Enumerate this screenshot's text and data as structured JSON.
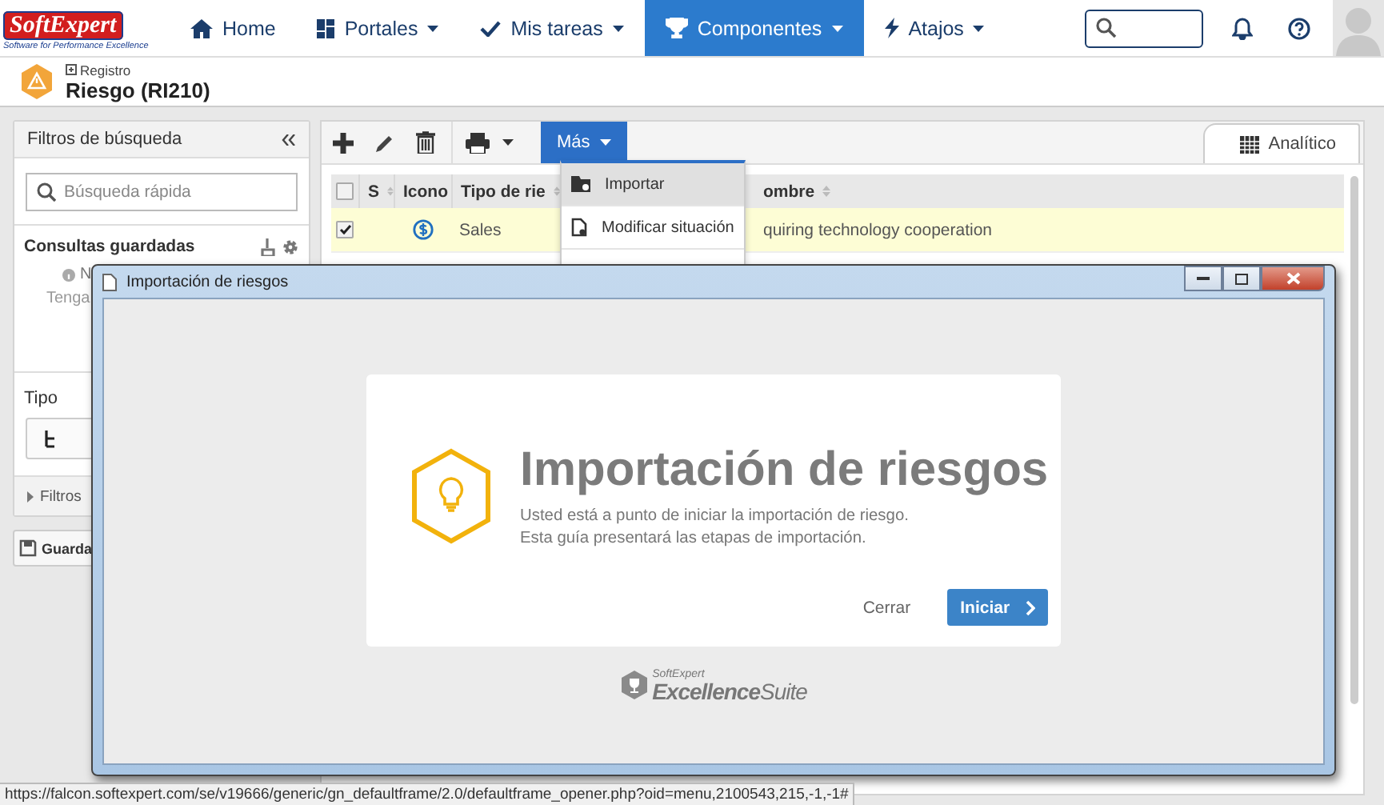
{
  "nav": {
    "logo": {
      "part_a": "Soft",
      "part_b": "Expert",
      "tagline": "Software for Performance Excellence"
    },
    "items": [
      {
        "label": "Home",
        "dropdown": false,
        "selected": false
      },
      {
        "label": "Portales",
        "dropdown": true,
        "selected": false
      },
      {
        "label": "Mis tareas",
        "dropdown": true,
        "selected": false
      },
      {
        "label": "Componentes",
        "dropdown": true,
        "selected": true
      },
      {
        "label": "Atajos",
        "dropdown": true,
        "selected": false
      }
    ]
  },
  "header": {
    "breadcrumb": "Registro",
    "title": "Riesgo (RI210)"
  },
  "filters": {
    "title": "Filtros de búsqueda",
    "search_placeholder": "Búsqueda rápida",
    "saved_title": "Consultas guardadas",
    "saved_note": "N",
    "saved_hint": "Tenga",
    "type_title": "Tipo",
    "more_filters": "Filtros",
    "save_button": "Guarda"
  },
  "toolbar": {
    "more_button": "Más",
    "view_tab": {
      "label": "Analítico",
      "selected": true
    }
  },
  "table": {
    "header_checked": false,
    "columns": [
      "S",
      "Icono",
      "Tipo de rie",
      "ombre"
    ],
    "rows": [
      {
        "checked": true,
        "selected": true,
        "type": "Sales",
        "name": "quiring technology cooperation"
      }
    ]
  },
  "menu": [
    {
      "label": "Importar",
      "selected": true
    },
    {
      "label": "Modificar situación",
      "selected": false
    }
  ],
  "dialog": {
    "window_title": "Importación de riesgos",
    "heading": "Importación de riesgos",
    "lines": [
      "Usted está a punto de iniciar la importación de riesgo.",
      "Esta guía presentará las etapas de importación."
    ],
    "cancel": "Cerrar",
    "primary": "Iniciar",
    "brand": {
      "small": "SoftExpert",
      "part_a": "Excellence",
      "part_b": "Suite"
    }
  },
  "status_url": "https://falcon.softexpert.com/se/v19666/generic/gn_defaultframe/2.0/defaultframe_opener.php?oid=menu,2100543,215,-1,-1#"
}
